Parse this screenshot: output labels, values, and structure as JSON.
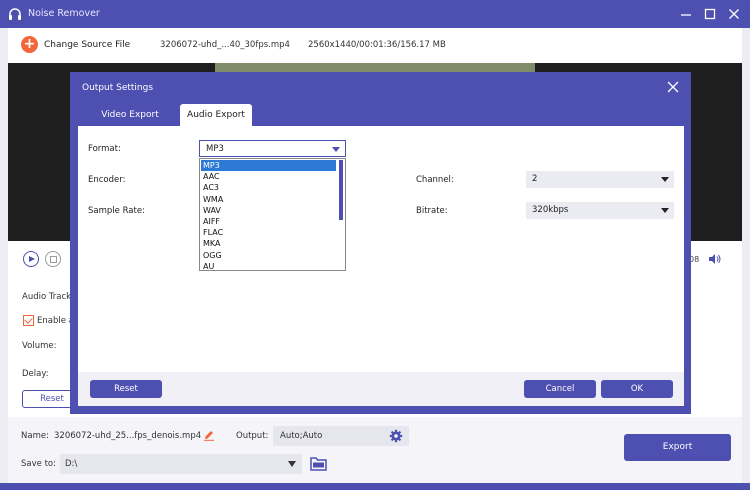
{
  "app": {
    "title": "Noise Remover"
  },
  "source": {
    "change_label": "Change Source File",
    "file_name": "3206072-uhd_...40_30fps.mp4",
    "file_meta": "2560x1440/00:01:36/156.17 MB"
  },
  "player": {
    "time_tail": "08"
  },
  "audio": {
    "track_label": "Audio Track",
    "enable_label": "Enable a",
    "volume_label": "Volume:",
    "delay_label": "Delay:",
    "reset_label": "Reset"
  },
  "bottom": {
    "name_label": "Name:",
    "name_value": "3206072-uhd_25...fps_denois.mp4",
    "output_label": "Output:",
    "output_value": "Auto;Auto",
    "saveto_label": "Save to:",
    "saveto_value": "D:\\",
    "export_label": "Export"
  },
  "modal": {
    "title": "Output Settings",
    "tabs": [
      {
        "label": "Video Export",
        "active": false
      },
      {
        "label": "Audio Export",
        "active": true
      }
    ],
    "format_label": "Format:",
    "format_value": "MP3",
    "encoder_label": "Encoder:",
    "sample_rate_label": "Sample Rate:",
    "channel_label": "Channel:",
    "channel_value": "2",
    "bitrate_label": "Bitrate:",
    "bitrate_value": "320kbps",
    "format_options": [
      "MP3",
      "AAC",
      "AC3",
      "WMA",
      "WAV",
      "AIFF",
      "FLAC",
      "MKA",
      "OGG",
      "AU"
    ],
    "reset_label": "Reset",
    "cancel_label": "Cancel",
    "ok_label": "OK"
  },
  "colors": {
    "accent": "#4d4fb1",
    "orange": "#f2663a",
    "selection": "#2d7ad6"
  }
}
